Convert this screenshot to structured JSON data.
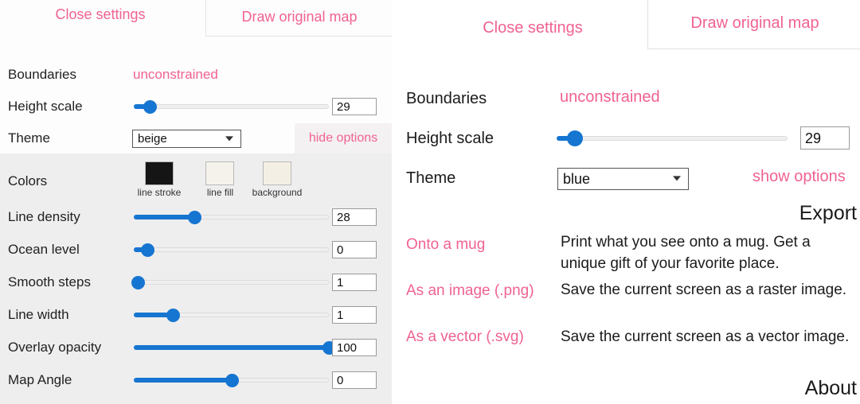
{
  "app": {
    "accent_pink": "#f06292",
    "accent_blue": "#1675d1",
    "panel_grey": "#eeeeee"
  },
  "left_panel": {
    "tabs": [
      {
        "label": "Close settings",
        "active": true
      },
      {
        "label": "Draw original map",
        "active": false
      }
    ],
    "rows": {
      "boundaries_label": "Boundaries",
      "boundaries_value": "unconstrained",
      "height_scale_label": "Height scale",
      "height_scale_value": "29",
      "theme_label": "Theme",
      "theme_value": "beige",
      "toggle_options": "hide options"
    },
    "options": {
      "colors_label": "Colors",
      "swatches": [
        {
          "caption": "line stroke",
          "color": "#151515"
        },
        {
          "caption": "line fill",
          "color": "#f5f2ec"
        },
        {
          "caption": "background",
          "color": "#f4efe4"
        }
      ],
      "sliders": [
        {
          "label": "Line density",
          "value": "28",
          "percent": 31
        },
        {
          "label": "Ocean level",
          "value": "0",
          "percent": 7
        },
        {
          "label": "Smooth steps",
          "value": "1",
          "percent": 0
        },
        {
          "label": "Line width",
          "value": "1",
          "percent": 20
        },
        {
          "label": "Overlay opacity",
          "value": "100",
          "percent": 100
        },
        {
          "label": "Map Angle",
          "value": "0",
          "percent": 50
        }
      ]
    }
  },
  "right_panel": {
    "tabs": [
      {
        "label": "Close settings",
        "active": true
      },
      {
        "label": "Draw original map",
        "active": false
      }
    ],
    "rows": {
      "boundaries_label": "Boundaries",
      "boundaries_value": "unconstrained",
      "height_scale_label": "Height scale",
      "height_scale_value": "29",
      "height_scale_percent": 7,
      "theme_label": "Theme",
      "theme_value": "blue",
      "toggle_options": "show options"
    },
    "export": {
      "heading": "Export",
      "items": [
        {
          "link": "Onto a mug",
          "desc": "Print what you see onto a mug. Get a unique gift of your favorite place."
        },
        {
          "link": "As an image (.png)",
          "desc": "Save the current screen as a raster image."
        },
        {
          "link": "As a vector (.svg)",
          "desc": "Save the current screen as a vector image."
        }
      ]
    },
    "about": {
      "heading": "About"
    }
  }
}
